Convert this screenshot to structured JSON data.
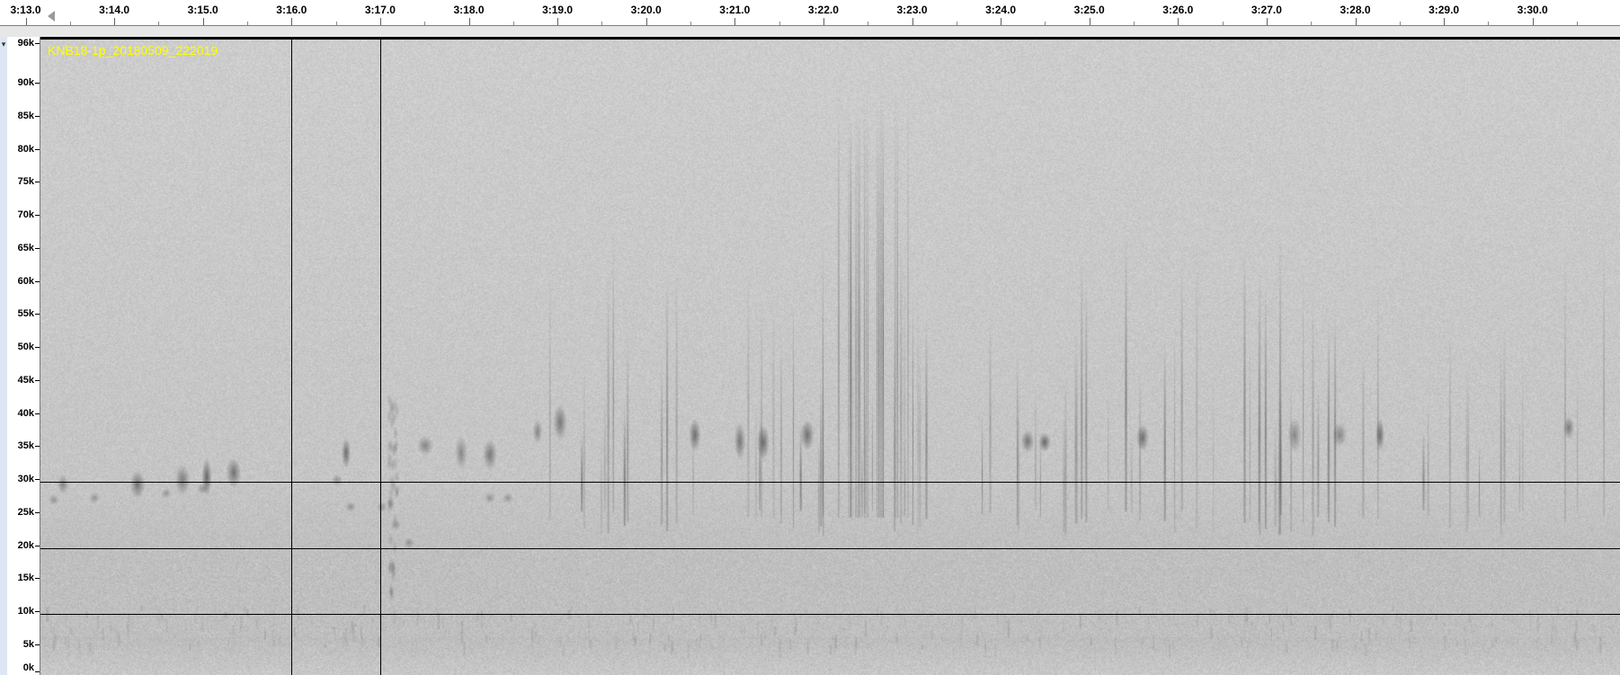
{
  "timeline": {
    "labels": [
      "3:13.0",
      "3:14.0",
      "3:15.0",
      "3:16.0",
      "3:17.0",
      "3:18.0",
      "3:19.0",
      "3:20.0",
      "3:21.0",
      "3:22.0",
      "3:23.0",
      "3:24.0",
      "3:25.0",
      "3:26.0",
      "3:27.0",
      "3:28.0",
      "3:29.0",
      "3:30.0"
    ]
  },
  "track": {
    "clip_name": "KNB18-1p_20180509_222019",
    "collapse_glyph": "▾",
    "clip_title_color": "#ffff00"
  },
  "frequency_axis": {
    "labels": [
      "96k",
      "90k",
      "85k",
      "80k",
      "75k",
      "70k",
      "65k",
      "60k",
      "55k",
      "50k",
      "45k",
      "40k",
      "35k",
      "30k",
      "25k",
      "20k",
      "15k",
      "10k",
      "5k",
      "0k"
    ]
  },
  "spectrogram": {
    "colormap": "grayscale",
    "frequency_range_hz": [
      0,
      96000
    ],
    "time_range": [
      "3:13.0",
      "3:30.8"
    ],
    "horizontal_guides_hz": [
      30000,
      20000,
      10000
    ],
    "vertical_guides": [
      "3:16.0",
      "3:17.0"
    ]
  }
}
